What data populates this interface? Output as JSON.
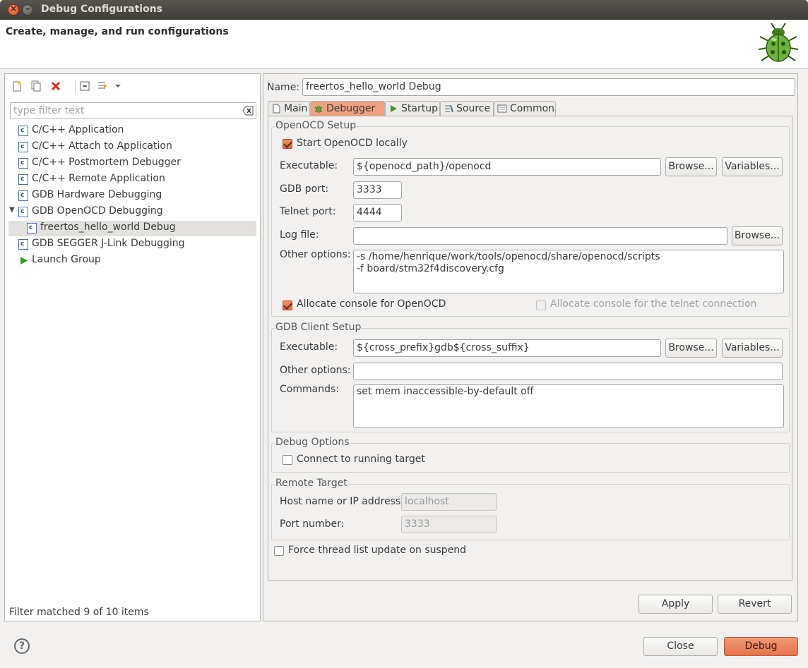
{
  "window": {
    "title": "Debug Configurations"
  },
  "header": {
    "title": "Create, manage, and run configurations"
  },
  "left": {
    "filter_placeholder": "type filter text",
    "items": [
      {
        "label": "C/C++ Application"
      },
      {
        "label": "C/C++ Attach to Application"
      },
      {
        "label": "C/C++ Postmortem Debugger"
      },
      {
        "label": "C/C++ Remote Application"
      },
      {
        "label": "GDB Hardware Debugging"
      },
      {
        "label": "GDB OpenOCD Debugging"
      },
      {
        "label": "freertos_hello_world Debug"
      },
      {
        "label": "GDB SEGGER J-Link Debugging"
      },
      {
        "label": "Launch Group"
      }
    ],
    "status": "Filter matched 9 of 10 items"
  },
  "config": {
    "name_label": "Name:",
    "name_value": "freertos_hello_world Debug",
    "tabs": [
      "Main",
      "Debugger",
      "Startup",
      "Source",
      "Common"
    ],
    "openocd": {
      "title": "OpenOCD Setup",
      "start_locally": "Start OpenOCD locally",
      "executable_label": "Executable:",
      "executable_value": "${openocd_path}/openocd",
      "browse": "Browse...",
      "variables": "Variables...",
      "gdb_port_label": "GDB port:",
      "gdb_port_value": "3333",
      "telnet_port_label": "Telnet port:",
      "telnet_port_value": "4444",
      "log_file_label": "Log file:",
      "log_file_value": "",
      "other_options_label": "Other options:",
      "other_options_value": "-s /home/henrique/work/tools/openocd/share/openocd/scripts\n-f board/stm32f4discovery.cfg",
      "allocate_console": "Allocate console for OpenOCD",
      "allocate_telnet": "Allocate console for the telnet connection"
    },
    "gdb": {
      "title": "GDB Client Setup",
      "executable_label": "Executable:",
      "executable_value": "${cross_prefix}gdb${cross_suffix}",
      "other_options_label": "Other options:",
      "other_options_value": "",
      "commands_label": "Commands:",
      "commands_value": "set mem inaccessible-by-default off"
    },
    "debug_options": {
      "title": "Debug Options",
      "connect": "Connect to running target"
    },
    "remote": {
      "title": "Remote Target",
      "host_label": "Host name or IP address:",
      "host_value": "localhost",
      "port_label": "Port number:",
      "port_value": "3333"
    },
    "force_thread": "Force thread list update on suspend",
    "apply": "Apply",
    "revert": "Revert"
  },
  "footer": {
    "help": "?",
    "close": "Close",
    "debug": "Debug"
  },
  "colors": {
    "accent": "#e6744b",
    "titlebar": "#3e3d39"
  }
}
